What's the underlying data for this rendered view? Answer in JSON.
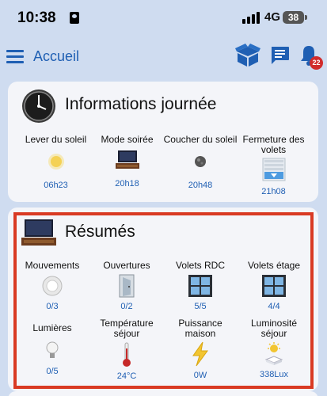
{
  "status_bar": {
    "time": "10:38",
    "network": "4G",
    "battery": "38"
  },
  "header": {
    "title": "Accueil",
    "notification_count": "22",
    "accent": "#1f5fb3"
  },
  "info_card": {
    "title": "Informations journée",
    "items": [
      {
        "label": "Lever du soleil",
        "value": "06h23",
        "icon": "sun-icon"
      },
      {
        "label": "Mode soirée",
        "value": "20h18",
        "icon": "tv-icon"
      },
      {
        "label": "Coucher du soleil",
        "value": "20h48",
        "icon": "moon-icon"
      },
      {
        "label": "Fermeture des volets",
        "value": "21h08",
        "icon": "shutter-icon"
      }
    ]
  },
  "summary_card": {
    "title": "Résumés",
    "items": [
      {
        "label": "Mouvements",
        "value": "0/3",
        "icon": "motion-sensor-icon"
      },
      {
        "label": "Ouvertures",
        "value": "0/2",
        "icon": "door-icon"
      },
      {
        "label": "Volets RDC",
        "value": "5/5",
        "icon": "window-icon"
      },
      {
        "label": "Volets étage",
        "value": "4/4",
        "icon": "window-icon"
      },
      {
        "label": "Lumières",
        "value": "0/5",
        "icon": "bulb-icon"
      },
      {
        "label": "Température séjour",
        "value": "24°C",
        "icon": "thermometer-icon"
      },
      {
        "label": "Puissance maison",
        "value": "0W",
        "icon": "lightning-icon"
      },
      {
        "label": "Luminosité séjour",
        "value": "338Lux",
        "icon": "brightness-icon"
      }
    ]
  }
}
